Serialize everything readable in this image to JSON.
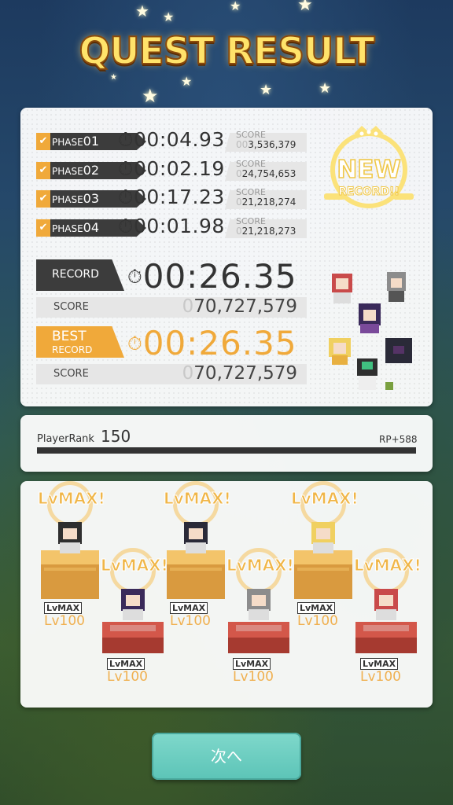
{
  "title": "QUEST RESULT",
  "phases": [
    {
      "label": "PHASE",
      "num": "01",
      "time": "00:04.93",
      "score_label": "SCORE",
      "score_zeros": "00",
      "score": "3,536,379"
    },
    {
      "label": "PHASE",
      "num": "02",
      "time": "00:02.19",
      "score_label": "SCORE",
      "score_zeros": "0",
      "score": "24,754,653"
    },
    {
      "label": "PHASE",
      "num": "03",
      "time": "00:17.23",
      "score_label": "SCORE",
      "score_zeros": "0",
      "score": "21,218,274"
    },
    {
      "label": "PHASE",
      "num": "04",
      "time": "00:01.98",
      "score_label": "SCORE",
      "score_zeros": "0",
      "score": "21,218,273"
    }
  ],
  "record": {
    "label": "RECORD",
    "time": "00:26.35",
    "score_label": "SCORE",
    "score_zeros": "0",
    "score": "70,727,579"
  },
  "best": {
    "label_top": "BEST",
    "label_bottom": "RECORD",
    "time": "00:26.35",
    "score_label": "SCORE",
    "score_zeros": "0",
    "score": "70,727,579"
  },
  "new_record": {
    "line1": "NEW",
    "line2": "RECORD!!"
  },
  "player": {
    "rank_label": "PlayerRank",
    "rank": "150",
    "rp": "RP+588",
    "progress": 1.0
  },
  "units": [
    {
      "lvmax": "LvMAX!",
      "badge": "LvMAX",
      "level": "Lv100",
      "pedestal": "gold"
    },
    {
      "lvmax": "LvMAX!",
      "badge": "LvMAX",
      "level": "Lv100",
      "pedestal": "red"
    },
    {
      "lvmax": "LvMAX!",
      "badge": "LvMAX",
      "level": "Lv100",
      "pedestal": "gold"
    },
    {
      "lvmax": "LvMAX!",
      "badge": "LvMAX",
      "level": "Lv100",
      "pedestal": "red"
    },
    {
      "lvmax": "LvMAX!",
      "badge": "LvMAX",
      "level": "Lv100",
      "pedestal": "gold"
    },
    {
      "lvmax": "LvMAX!",
      "badge": "LvMAX",
      "level": "Lv100",
      "pedestal": "red"
    }
  ],
  "next_button": "次へ",
  "colors": {
    "accent": "#f0a93a",
    "dark_tag": "#3c3c3c",
    "button": "#5cc4b7",
    "gold": "#f0b648"
  },
  "icons": {
    "timer": "stopwatch-icon",
    "check": "checkmark-icon"
  }
}
